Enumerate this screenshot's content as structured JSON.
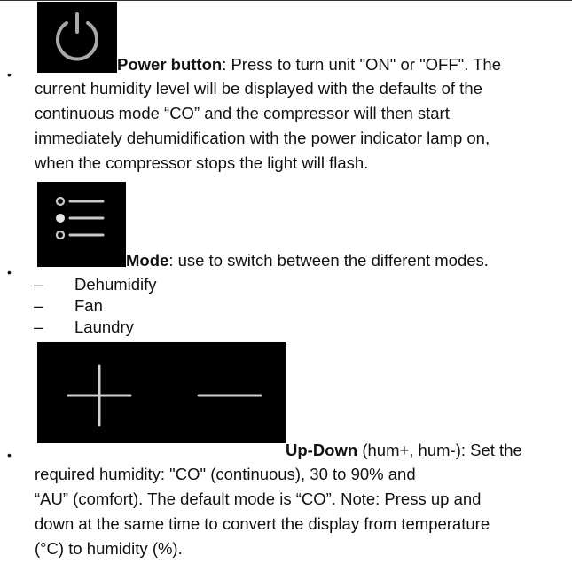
{
  "items": [
    {
      "icon": "power-icon",
      "title": "Power button",
      "first_line": ": Press to turn unit \"ON\" or \"OFF\". The",
      "lines": [
        "current humidity level will be displayed with the defaults of the",
        "continuous mode “CO” and the compressor will then start",
        "immediately dehumidification with the power indicator lamp on,",
        "when the compressor stops the light will flash."
      ]
    },
    {
      "icon": "mode-list-icon",
      "title": "Mode",
      "first_line": ": use to switch between the different modes.",
      "sub_items": [
        "Dehumidify",
        "Fan",
        "Laundry"
      ]
    },
    {
      "icon": "plus-minus-icon",
      "title": "Up-Down",
      "first_line": " (hum+, hum-): Set the",
      "lines": [
        "required humidity: \"CO\" (continuous), 30 to 90% and",
        "“AU” (comfort). The default mode is “CO”. Note: Press up and",
        "down at the same time to convert the display from temperature",
        "(°C) to humidity (%)."
      ]
    }
  ]
}
